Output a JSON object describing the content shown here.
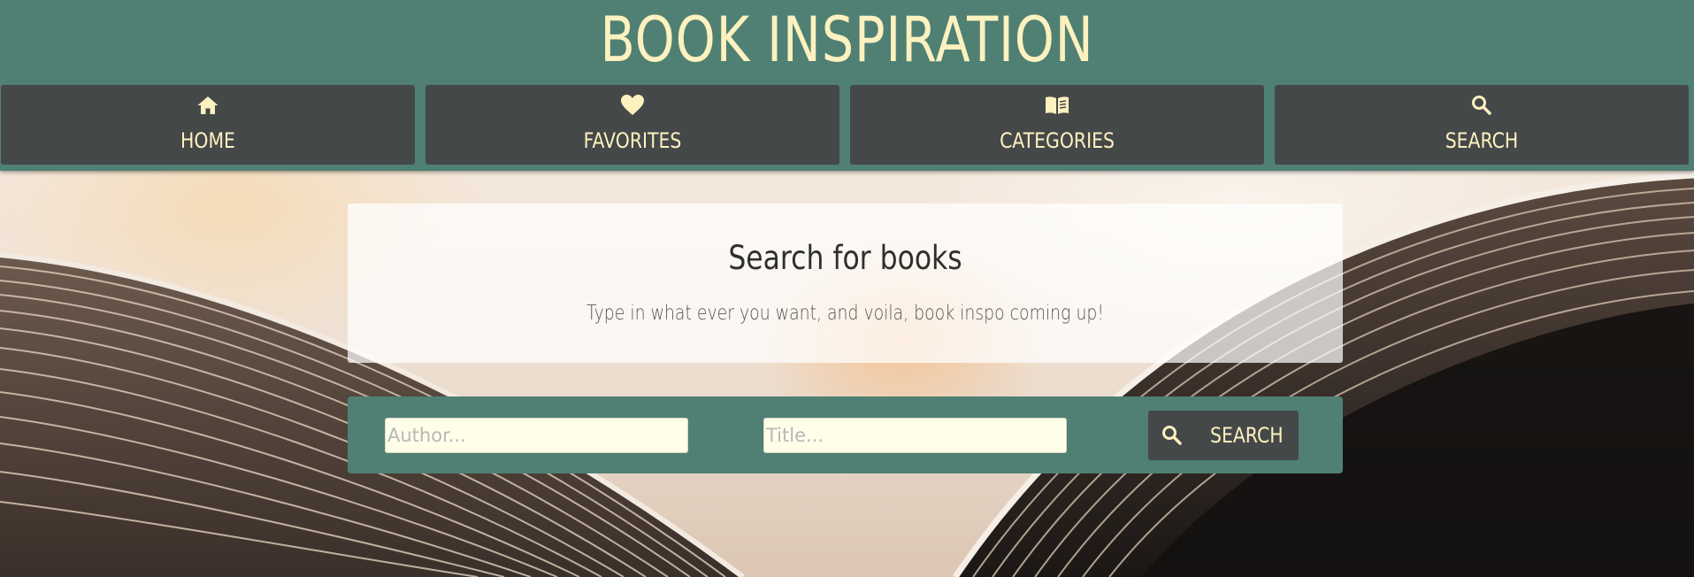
{
  "site": {
    "title": "BOOK INSPIRATION"
  },
  "nav": {
    "items": [
      {
        "label": "HOME",
        "icon": "home-icon"
      },
      {
        "label": "FAVORITES",
        "icon": "heart-icon"
      },
      {
        "label": "CATEGORIES",
        "icon": "book-open-icon"
      },
      {
        "label": "SEARCH",
        "icon": "search-icon"
      }
    ]
  },
  "intro": {
    "title": "Search for books",
    "text": "Type in what ever you want, and voila, book inspo coming up!"
  },
  "search_form": {
    "author_placeholder": "Author...",
    "author_value": "",
    "title_placeholder": "Title...",
    "title_value": "",
    "button_label": "SEARCH",
    "button_icon": "search-icon"
  },
  "colors": {
    "header_bg": "#4f8073",
    "nav_bg": "#454848",
    "accent_text": "#fdf1bf",
    "input_bg": "#fefee9"
  }
}
